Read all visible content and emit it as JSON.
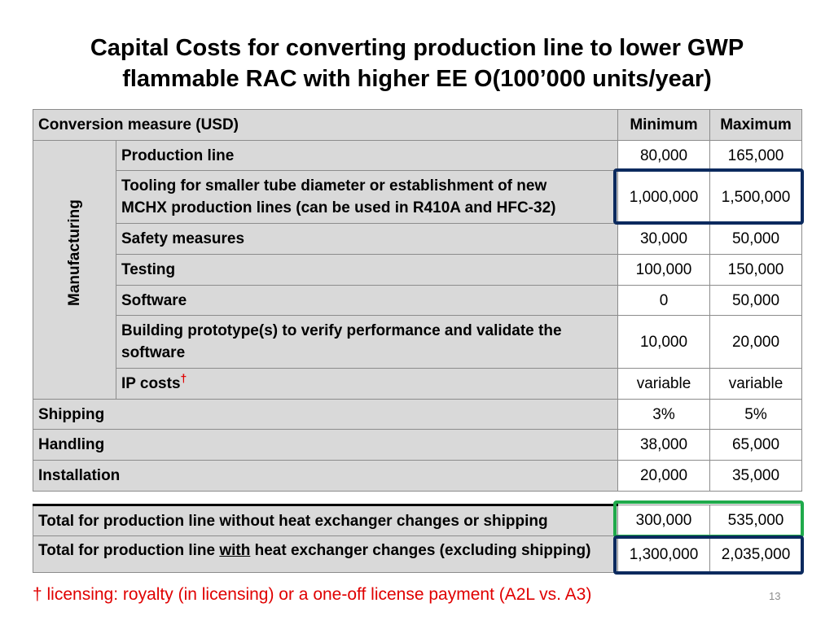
{
  "title_line1": "Capital Costs for converting production line to lower GWP",
  "title_line2": "flammable RAC with higher EE O(100’000 units/year)",
  "header": {
    "measure": "Conversion measure (USD)",
    "min": "Minimum",
    "max": "Maximum"
  },
  "group_label": "Manufacturing",
  "manufacturing_rows": [
    {
      "label": "Production line",
      "min": "80,000",
      "max": "165,000"
    },
    {
      "label_line1": "Tooling for smaller tube diameter or establishment of new",
      "label_line2": "MCHX production lines (can be used in R410A and HFC-32)",
      "min": "1,000,000",
      "max": "1,500,000"
    },
    {
      "label": "Safety measures",
      "min": "30,000",
      "max": "50,000"
    },
    {
      "label": "Testing",
      "min": "100,000",
      "max": "150,000"
    },
    {
      "label": "Software",
      "min": "0",
      "max": "50,000"
    },
    {
      "label_line1": "Building prototype(s) to verify performance and validate the",
      "label_line2": "software",
      "min": "10,000",
      "max": "20,000"
    },
    {
      "label": "IP costs",
      "dagger": "†",
      "min": "variable",
      "max": "variable"
    }
  ],
  "other_rows": [
    {
      "label": "Shipping",
      "min": "3%",
      "max": "5%"
    },
    {
      "label": "Handling",
      "min": "38,000",
      "max": "65,000"
    },
    {
      "label": "Installation",
      "min": "20,000",
      "max": "35,000"
    }
  ],
  "totals": [
    {
      "label": "Total for production line without heat exchanger changes or shipping",
      "min": "300,000",
      "max": "535,000"
    },
    {
      "label_pre": "Total for production line ",
      "label_u": "with",
      "label_post": " heat exchanger changes (excluding shipping)",
      "min": "1,300,000",
      "max": "2,035,000"
    }
  ],
  "footnote": "† licensing: royalty (in licensing) or a one-off license payment (A2L vs. A3)",
  "page_number": "13",
  "colors": {
    "highlight_navy": "#0b2a5e",
    "highlight_green": "#1faa4b",
    "dagger_red": "#e00000",
    "cell_gray": "#d9d9d9"
  }
}
